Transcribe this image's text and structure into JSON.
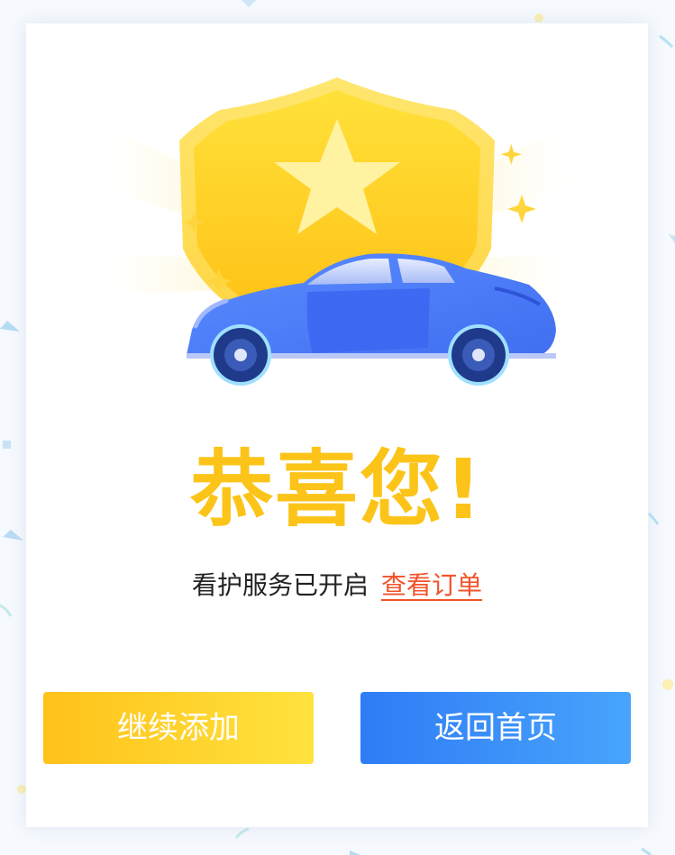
{
  "result": {
    "headline": "恭喜您!",
    "status_message": "看护服务已开启",
    "view_order_link": "查看订单"
  },
  "actions": {
    "continue_add_label": "继续添加",
    "back_home_label": "返回首页"
  },
  "illustration": {
    "icons": [
      "shield-star-icon",
      "car-icon",
      "sparkle-icon"
    ]
  },
  "colors": {
    "accent_yellow": "#fcc419",
    "link_orange": "#f2532a",
    "button_yellow_start": "#ffc21a",
    "button_yellow_end": "#ffe23e",
    "button_blue_start": "#2f7cf6",
    "button_blue_end": "#48a4fb",
    "car_blue": "#4f7ef8"
  }
}
